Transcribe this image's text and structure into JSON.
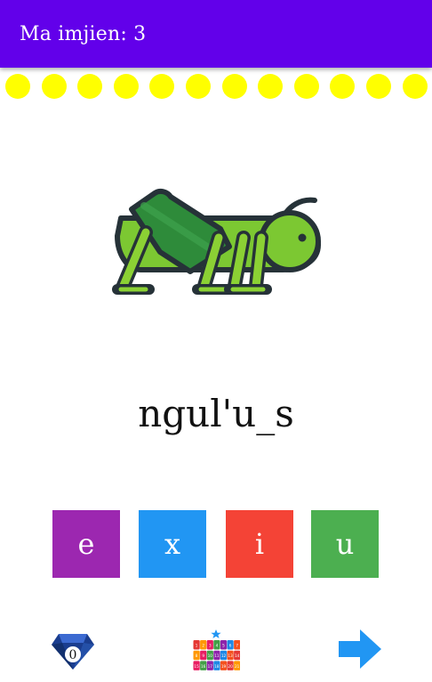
{
  "appbar": {
    "title": "Ma imjien: 3"
  },
  "progress": {
    "dot_count": 12,
    "dot_color": "#ffff00"
  },
  "picture": {
    "icon": "grasshopper-icon"
  },
  "word": {
    "text": "ngul'u_s"
  },
  "choices": [
    {
      "label": "e",
      "color": "#9c27b0"
    },
    {
      "label": "x",
      "color": "#2196f3"
    },
    {
      "label": "i",
      "color": "#f44336"
    },
    {
      "label": "u",
      "color": "#4caf50"
    }
  ],
  "bottom_bar": {
    "gem_count": "0",
    "calendar_numbers": [
      "1",
      "2",
      "3",
      "4",
      "5",
      "6",
      "7",
      "8",
      "9",
      "10",
      "11",
      "12",
      "13",
      "14",
      "15",
      "16",
      "17",
      "18",
      "19",
      "20",
      "21"
    ],
    "next_icon": "arrow-right-icon"
  },
  "colors": {
    "appbar": "#6200ea",
    "accent_blue": "#2196f3"
  }
}
